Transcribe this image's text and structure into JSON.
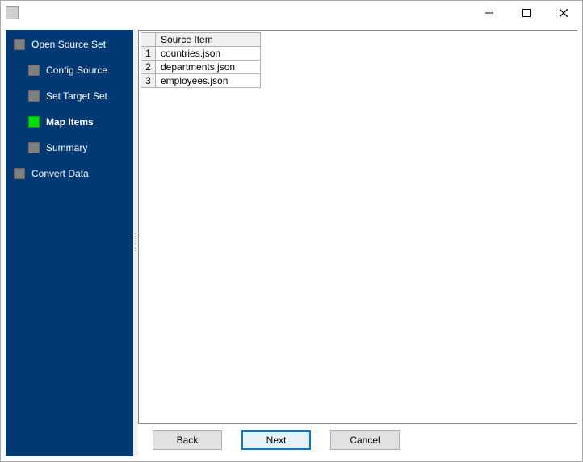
{
  "window": {
    "title": ""
  },
  "wizard": {
    "steps": [
      {
        "label": "Open Source Set",
        "level": 0,
        "active": false
      },
      {
        "label": "Config Source",
        "level": 1,
        "active": false
      },
      {
        "label": "Set Target Set",
        "level": 1,
        "active": false
      },
      {
        "label": "Map Items",
        "level": 1,
        "active": true
      },
      {
        "label": "Summary",
        "level": 1,
        "active": false
      },
      {
        "label": "Convert Data",
        "level": 0,
        "active": false
      }
    ]
  },
  "table": {
    "header": "Source Item",
    "rows": [
      {
        "n": "1",
        "item": "countries.json"
      },
      {
        "n": "2",
        "item": "departments.json"
      },
      {
        "n": "3",
        "item": "employees.json"
      }
    ]
  },
  "buttons": {
    "back": "Back",
    "next": "Next",
    "cancel": "Cancel"
  }
}
